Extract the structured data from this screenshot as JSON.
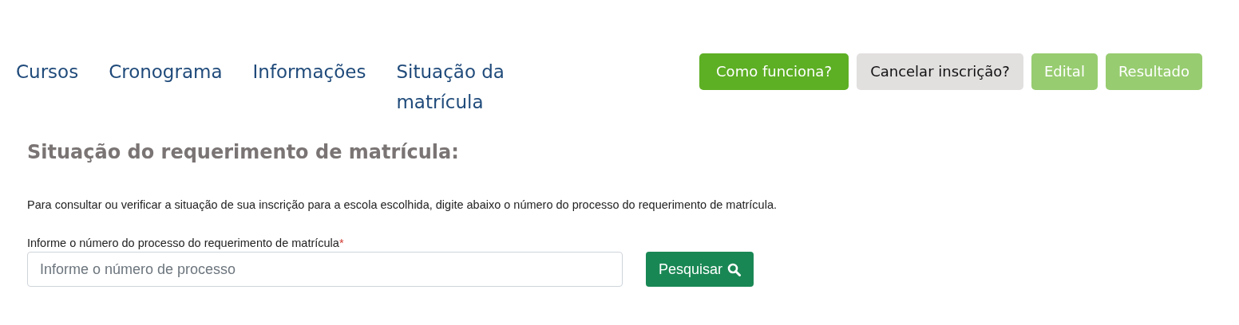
{
  "nav": {
    "items": [
      {
        "label": "Cursos"
      },
      {
        "label": "Cronograma"
      },
      {
        "label": "Informações"
      },
      {
        "label": "Situação da matrícula"
      }
    ]
  },
  "actions": [
    {
      "label": "Como funciona?",
      "kind": "primary"
    },
    {
      "label": "Cancelar inscrição?",
      "kind": "secondary"
    },
    {
      "label": "Edital",
      "kind": "light"
    },
    {
      "label": "Resultado",
      "kind": "light"
    }
  ],
  "heading": "Situação do requerimento de matrícula:",
  "intro": "Para consultar ou verificar a situação de sua inscrição para a escola escolhida, digite abaixo o número do processo do requerimento de matrícula.",
  "form": {
    "label": "Informe o número do processo do requerimento de matrícula",
    "required_mark": "*",
    "placeholder": "Informe o número de processo",
    "button": "Pesquisar"
  }
}
